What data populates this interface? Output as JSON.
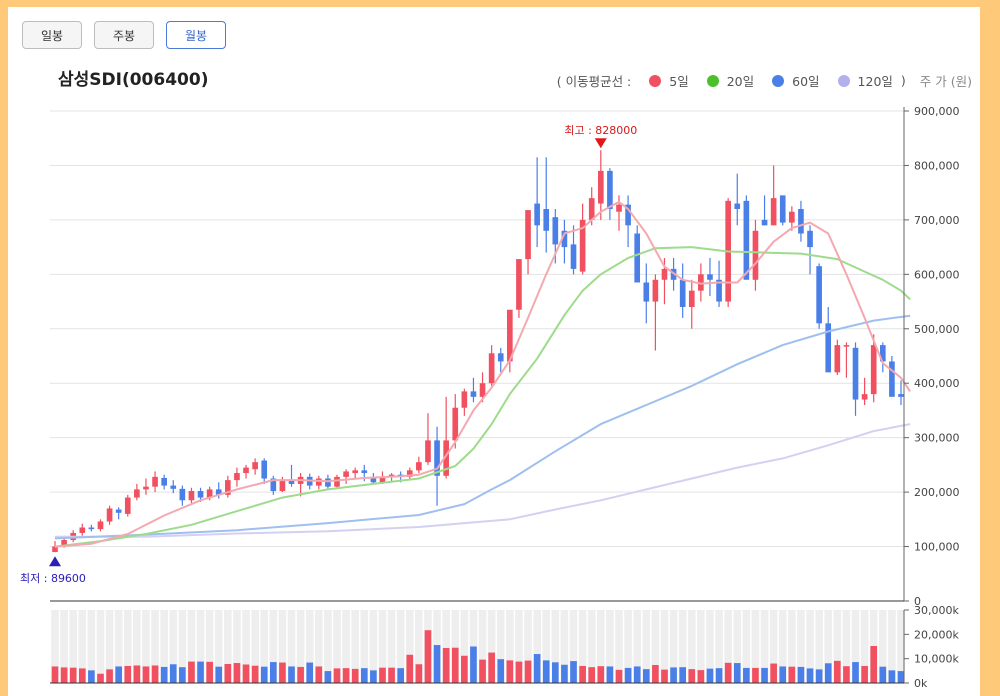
{
  "tabs": [
    {
      "label": "일봉",
      "active": false
    },
    {
      "label": "주봉",
      "active": false
    },
    {
      "label": "월봉",
      "active": true
    }
  ],
  "title": "삼성SDI(006400)",
  "legend": {
    "prefix": "( 이동평균선 :",
    "suffix": ")",
    "unit": "주 가 (원)",
    "items": [
      {
        "label": "5일",
        "color": "#f0505f"
      },
      {
        "label": "20일",
        "color": "#4cbf2c"
      },
      {
        "label": "60일",
        "color": "#4b7fe8"
      },
      {
        "label": "120일",
        "color": "#b3b0ec"
      }
    ]
  },
  "chart_data": {
    "type": "candlestick",
    "up_color": "#f0505f",
    "down_color": "#4b7fe8",
    "price_ticks": [
      "0",
      "100,000",
      "200,000",
      "300,000",
      "400,000",
      "500,000",
      "600,000",
      "700,000",
      "800,000",
      "900,000"
    ],
    "price_range": [
      0,
      900000
    ],
    "volume_ticks": [
      "0k",
      "10,000k",
      "20,000k",
      "30,000k"
    ],
    "volume_range": [
      0,
      30000
    ],
    "high_label": "최고 : 828000",
    "low_label": "최저 : 89600",
    "high_value": 828000,
    "low_value": 89600,
    "candles": [
      [
        90000,
        110000,
        89600,
        100000
      ],
      [
        100000,
        120000,
        98000,
        112000
      ],
      [
        112000,
        130000,
        108000,
        125000
      ],
      [
        125000,
        142000,
        120000,
        135000
      ],
      [
        135000,
        140000,
        128000,
        132000
      ],
      [
        132000,
        150000,
        128000,
        146000
      ],
      [
        146000,
        175000,
        140000,
        170000
      ],
      [
        168000,
        172000,
        150000,
        162000
      ],
      [
        160000,
        195000,
        155000,
        190000
      ],
      [
        190000,
        215000,
        185000,
        205000
      ],
      [
        205000,
        225000,
        195000,
        210000
      ],
      [
        210000,
        238000,
        200000,
        228000
      ],
      [
        226000,
        232000,
        205000,
        212000
      ],
      [
        212000,
        222000,
        198000,
        206000
      ],
      [
        206000,
        212000,
        175000,
        185000
      ],
      [
        185000,
        208000,
        180000,
        202000
      ],
      [
        202000,
        208000,
        182000,
        190000
      ],
      [
        190000,
        210000,
        185000,
        205000
      ],
      [
        205000,
        218000,
        188000,
        195000
      ],
      [
        195000,
        230000,
        190000,
        222000
      ],
      [
        222000,
        245000,
        210000,
        235000
      ],
      [
        235000,
        250000,
        225000,
        245000
      ],
      [
        242000,
        262000,
        232000,
        255000
      ],
      [
        258000,
        262000,
        215000,
        225000
      ],
      [
        225000,
        230000,
        195000,
        202000
      ],
      [
        202000,
        228000,
        200000,
        222000
      ],
      [
        222000,
        250000,
        210000,
        215000
      ],
      [
        215000,
        235000,
        192000,
        228000
      ],
      [
        228000,
        234000,
        205000,
        212000
      ],
      [
        212000,
        230000,
        205000,
        225000
      ],
      [
        225000,
        232000,
        205000,
        210000
      ],
      [
        210000,
        232000,
        205000,
        228000
      ],
      [
        228000,
        242000,
        215000,
        238000
      ],
      [
        235000,
        245000,
        225000,
        240000
      ],
      [
        240000,
        250000,
        220000,
        235000
      ],
      [
        225000,
        235000,
        215000,
        218000
      ],
      [
        218000,
        238000,
        215000,
        228000
      ],
      [
        228000,
        235000,
        220000,
        232000
      ],
      [
        232000,
        238000,
        218000,
        228000
      ],
      [
        228000,
        245000,
        222000,
        240000
      ],
      [
        240000,
        265000,
        235000,
        255000
      ],
      [
        255000,
        345000,
        250000,
        295000
      ],
      [
        295000,
        320000,
        175000,
        230000
      ],
      [
        230000,
        375000,
        225000,
        295000
      ],
      [
        295000,
        380000,
        280000,
        355000
      ],
      [
        355000,
        390000,
        340000,
        385000
      ],
      [
        385000,
        410000,
        365000,
        375000
      ],
      [
        375000,
        420000,
        365000,
        400000
      ],
      [
        400000,
        470000,
        395000,
        455000
      ],
      [
        455000,
        465000,
        420000,
        440000
      ],
      [
        440000,
        525000,
        420000,
        535000
      ],
      [
        535000,
        580000,
        520000,
        628000
      ],
      [
        628000,
        680000,
        600000,
        718000
      ],
      [
        730000,
        815000,
        650000,
        690000
      ],
      [
        720000,
        815000,
        640000,
        680000
      ],
      [
        705000,
        720000,
        620000,
        655000
      ],
      [
        680000,
        700000,
        620000,
        650000
      ],
      [
        655000,
        690000,
        600000,
        610000
      ],
      [
        605000,
        730000,
        600000,
        700000
      ],
      [
        700000,
        760000,
        690000,
        740000
      ],
      [
        730000,
        828000,
        700000,
        790000
      ],
      [
        790000,
        795000,
        700000,
        720000
      ],
      [
        715000,
        745000,
        680000,
        728000
      ],
      [
        728000,
        745000,
        650000,
        690000
      ],
      [
        675000,
        690000,
        600000,
        585000
      ],
      [
        585000,
        620000,
        510000,
        550000
      ],
      [
        550000,
        600000,
        460000,
        590000
      ],
      [
        590000,
        630000,
        545000,
        610000
      ],
      [
        610000,
        630000,
        570000,
        590000
      ],
      [
        590000,
        620000,
        520000,
        540000
      ],
      [
        540000,
        590000,
        500000,
        570000
      ],
      [
        570000,
        620000,
        550000,
        600000
      ],
      [
        600000,
        630000,
        560000,
        590000
      ],
      [
        590000,
        625000,
        540000,
        550000
      ],
      [
        550000,
        740000,
        540000,
        735000
      ],
      [
        730000,
        785000,
        690000,
        720000
      ],
      [
        735000,
        745000,
        600000,
        590000
      ],
      [
        590000,
        700000,
        570000,
        680000
      ],
      [
        700000,
        745000,
        690000,
        690000
      ],
      [
        690000,
        800000,
        690000,
        740000
      ],
      [
        745000,
        745000,
        690000,
        695000
      ],
      [
        695000,
        725000,
        680000,
        715000
      ],
      [
        720000,
        735000,
        660000,
        675000
      ],
      [
        680000,
        690000,
        600000,
        650000
      ],
      [
        615000,
        620000,
        500000,
        510000
      ],
      [
        510000,
        540000,
        420000,
        420000
      ],
      [
        420000,
        480000,
        415000,
        470000
      ],
      [
        470000,
        475000,
        410000,
        470000
      ],
      [
        465000,
        475000,
        340000,
        370000
      ],
      [
        370000,
        410000,
        360000,
        380000
      ],
      [
        380000,
        490000,
        365000,
        470000
      ],
      [
        470000,
        475000,
        420000,
        440000
      ],
      [
        440000,
        450000,
        380000,
        375000
      ],
      [
        380000,
        405000,
        360000,
        375000
      ]
    ],
    "volumes": [
      6800,
      6400,
      6300,
      6000,
      5200,
      3800,
      5600,
      6800,
      7000,
      7200,
      6800,
      7200,
      6600,
      7700,
      6500,
      8800,
      8800,
      8700,
      6700,
      7800,
      8200,
      7600,
      7100,
      6700,
      8600,
      8400,
      6800,
      6600,
      8400,
      6800,
      4900,
      6000,
      6100,
      5800,
      6100,
      5200,
      6300,
      6300,
      6100,
      11600,
      7700,
      21700,
      15600,
      14400,
      14500,
      11200,
      15000,
      9600,
      12500,
      9800,
      9300,
      8800,
      9200,
      11900,
      9300,
      8500,
      7500,
      9000,
      7000,
      6500,
      6900,
      6800,
      5400,
      6200,
      6800,
      5700,
      7400,
      5500,
      6400,
      6500,
      5700,
      5300,
      5900,
      6100,
      8300,
      8200,
      6200,
      6200,
      6200,
      8000,
      6800,
      6700,
      6600,
      6000,
      5600,
      8100,
      9100,
      6900,
      8600,
      7000,
      15200,
      6700,
      5200,
      4900
    ],
    "ma": {
      "ma5": [
        [
          0,
          99600
        ],
        [
          4,
          105000
        ],
        [
          8,
          123000
        ],
        [
          12,
          157000
        ],
        [
          16,
          185000
        ],
        [
          20,
          205000
        ],
        [
          24,
          222000
        ],
        [
          27,
          222000
        ],
        [
          30,
          220000
        ],
        [
          34,
          226000
        ],
        [
          38,
          229000
        ],
        [
          40,
          232000
        ],
        [
          42,
          243000
        ],
        [
          44,
          292000
        ],
        [
          46,
          350000
        ],
        [
          48,
          392000
        ],
        [
          50,
          442000
        ],
        [
          52,
          520000
        ],
        [
          54,
          600000
        ],
        [
          56,
          675000
        ],
        [
          58,
          685000
        ],
        [
          60,
          715000
        ],
        [
          62,
          733000
        ],
        [
          63,
          720000
        ],
        [
          65,
          675000
        ],
        [
          67,
          614000
        ],
        [
          69,
          590000
        ],
        [
          71,
          583000
        ],
        [
          73,
          585000
        ],
        [
          75,
          585000
        ],
        [
          77,
          620000
        ],
        [
          79,
          660000
        ],
        [
          81,
          685000
        ],
        [
          83,
          695000
        ],
        [
          85,
          675000
        ],
        [
          87,
          600000
        ],
        [
          89,
          520000
        ],
        [
          91,
          437000
        ],
        [
          93,
          410000
        ],
        [
          94,
          385000
        ]
      ],
      "ma20": [
        [
          0,
          100000
        ],
        [
          5,
          110000
        ],
        [
          10,
          123000
        ],
        [
          15,
          140000
        ],
        [
          20,
          165000
        ],
        [
          25,
          190000
        ],
        [
          30,
          205000
        ],
        [
          35,
          215000
        ],
        [
          40,
          225000
        ],
        [
          44,
          248000
        ],
        [
          46,
          280000
        ],
        [
          48,
          325000
        ],
        [
          50,
          380000
        ],
        [
          53,
          445000
        ],
        [
          56,
          525000
        ],
        [
          58,
          570000
        ],
        [
          60,
          600000
        ],
        [
          63,
          630000
        ],
        [
          66,
          648000
        ],
        [
          70,
          650000
        ],
        [
          74,
          642000
        ],
        [
          78,
          640000
        ],
        [
          82,
          638000
        ],
        [
          86,
          628000
        ],
        [
          89,
          605000
        ],
        [
          91,
          590000
        ],
        [
          93,
          570000
        ],
        [
          94,
          554000
        ]
      ],
      "ma60": [
        [
          0,
          115000
        ],
        [
          10,
          122000
        ],
        [
          20,
          130000
        ],
        [
          30,
          143000
        ],
        [
          40,
          158000
        ],
        [
          45,
          178000
        ],
        [
          48,
          205000
        ],
        [
          50,
          222000
        ],
        [
          55,
          275000
        ],
        [
          60,
          325000
        ],
        [
          65,
          360000
        ],
        [
          70,
          395000
        ],
        [
          75,
          435000
        ],
        [
          80,
          470000
        ],
        [
          85,
          495000
        ],
        [
          90,
          515000
        ],
        [
          94,
          524000
        ]
      ],
      "ma120": [
        [
          0,
          118000
        ],
        [
          10,
          118000
        ],
        [
          20,
          124000
        ],
        [
          30,
          128000
        ],
        [
          40,
          136000
        ],
        [
          50,
          150000
        ],
        [
          55,
          168000
        ],
        [
          60,
          185000
        ],
        [
          65,
          205000
        ],
        [
          70,
          225000
        ],
        [
          75,
          245000
        ],
        [
          80,
          262000
        ],
        [
          85,
          286000
        ],
        [
          90,
          312000
        ],
        [
          94,
          325000
        ]
      ]
    }
  }
}
